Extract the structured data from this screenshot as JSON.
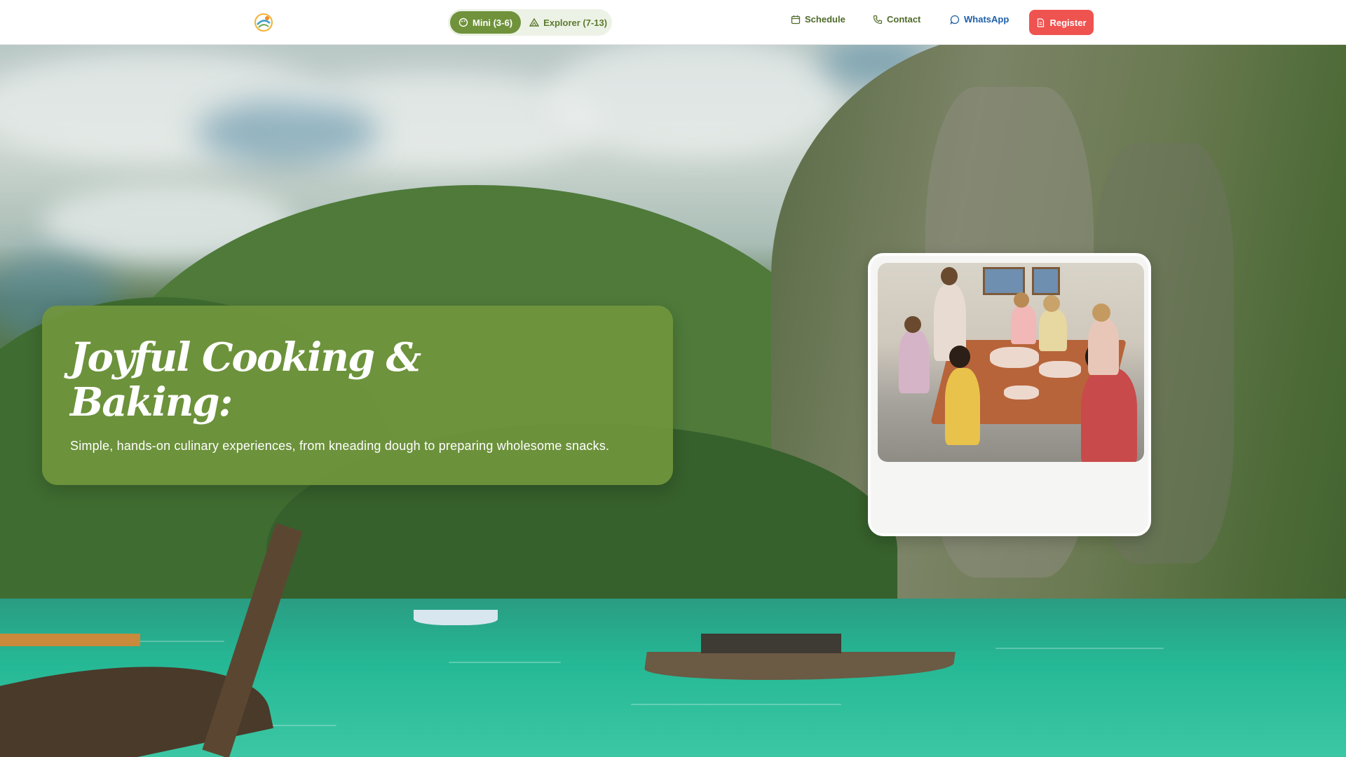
{
  "header": {
    "logo_icon": "sun-swirl-logo",
    "age_groups": [
      {
        "label": "Mini (3-6)",
        "icon": "palette-icon",
        "active": true
      },
      {
        "label": "Explorer (7-13)",
        "icon": "mountain-icon",
        "active": false
      }
    ],
    "nav": {
      "schedule": "Schedule",
      "contact": "Contact",
      "whatsapp": "WhatsApp",
      "register": "Register"
    }
  },
  "hero": {
    "title": "Joyful Cooking & Baking:",
    "subtitle": "Simple, hands-on culinary experiences, from kneading dough to preparing wholesome snacks."
  },
  "colors": {
    "accent_green": "#6f923b",
    "hero_card": "#70943c",
    "register_red": "#ef5350",
    "whatsapp_blue": "#1f5fa8"
  }
}
